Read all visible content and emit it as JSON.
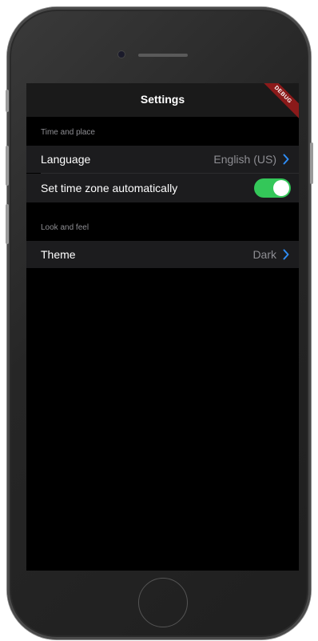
{
  "appbar": {
    "title": "Settings",
    "debug_banner": "DEBUG"
  },
  "sections": [
    {
      "header": "Time and place",
      "items": [
        {
          "label": "Language",
          "value": "English (US)",
          "control": "chevron-right-icon"
        },
        {
          "label": "Set time zone automatically",
          "control": "toggle",
          "toggle_on": true
        }
      ]
    },
    {
      "header": "Look and feel",
      "items": [
        {
          "label": "Theme",
          "value": "Dark",
          "control": "chevron-right-icon"
        }
      ]
    }
  ],
  "colors": {
    "accent": "#2f8df6",
    "toggle_on": "#34c759",
    "row_background": "#1c1c1e",
    "screen_background": "#000000",
    "secondary_text": "#8e8e93"
  }
}
